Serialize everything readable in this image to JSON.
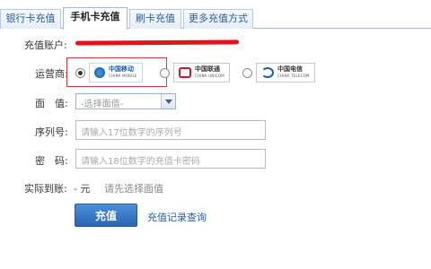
{
  "tabs": [
    {
      "label": "银行卡充值",
      "active": false
    },
    {
      "label": "手机卡充值",
      "active": true
    },
    {
      "label": "刷卡充值",
      "active": false
    },
    {
      "label": "更多充值方式",
      "active": false
    }
  ],
  "form": {
    "account_label": "充值账户:",
    "operator_label": "运营商:",
    "operators": [
      {
        "cn": "中国移动",
        "en": "CHINA MOBILE",
        "selected": true,
        "icon": "china-mobile-logo"
      },
      {
        "cn": "中国联通",
        "en": "CHINA UNICOM",
        "selected": false,
        "icon": "china-unicom-logo"
      },
      {
        "cn": "中国电信",
        "en": "CHINA TELECOM",
        "selected": false,
        "icon": "china-telecom-logo"
      }
    ],
    "denomination_label": "面　值:",
    "denomination_value": "-选择面值-",
    "serial_label": "序列号:",
    "serial_placeholder": "请输入17位数字的序列号",
    "password_label": "密　码:",
    "password_placeholder": "请输入18位数字的充值卡密码",
    "actual_label": "实际到账:",
    "actual_amount": "- 元",
    "actual_hint": "请先选择面值"
  },
  "actions": {
    "submit_label": "充值",
    "records_link": "充值记录查询"
  },
  "colors": {
    "accent": "#2b66b4",
    "highlight": "#e23636",
    "redaction": "#e3121b"
  }
}
